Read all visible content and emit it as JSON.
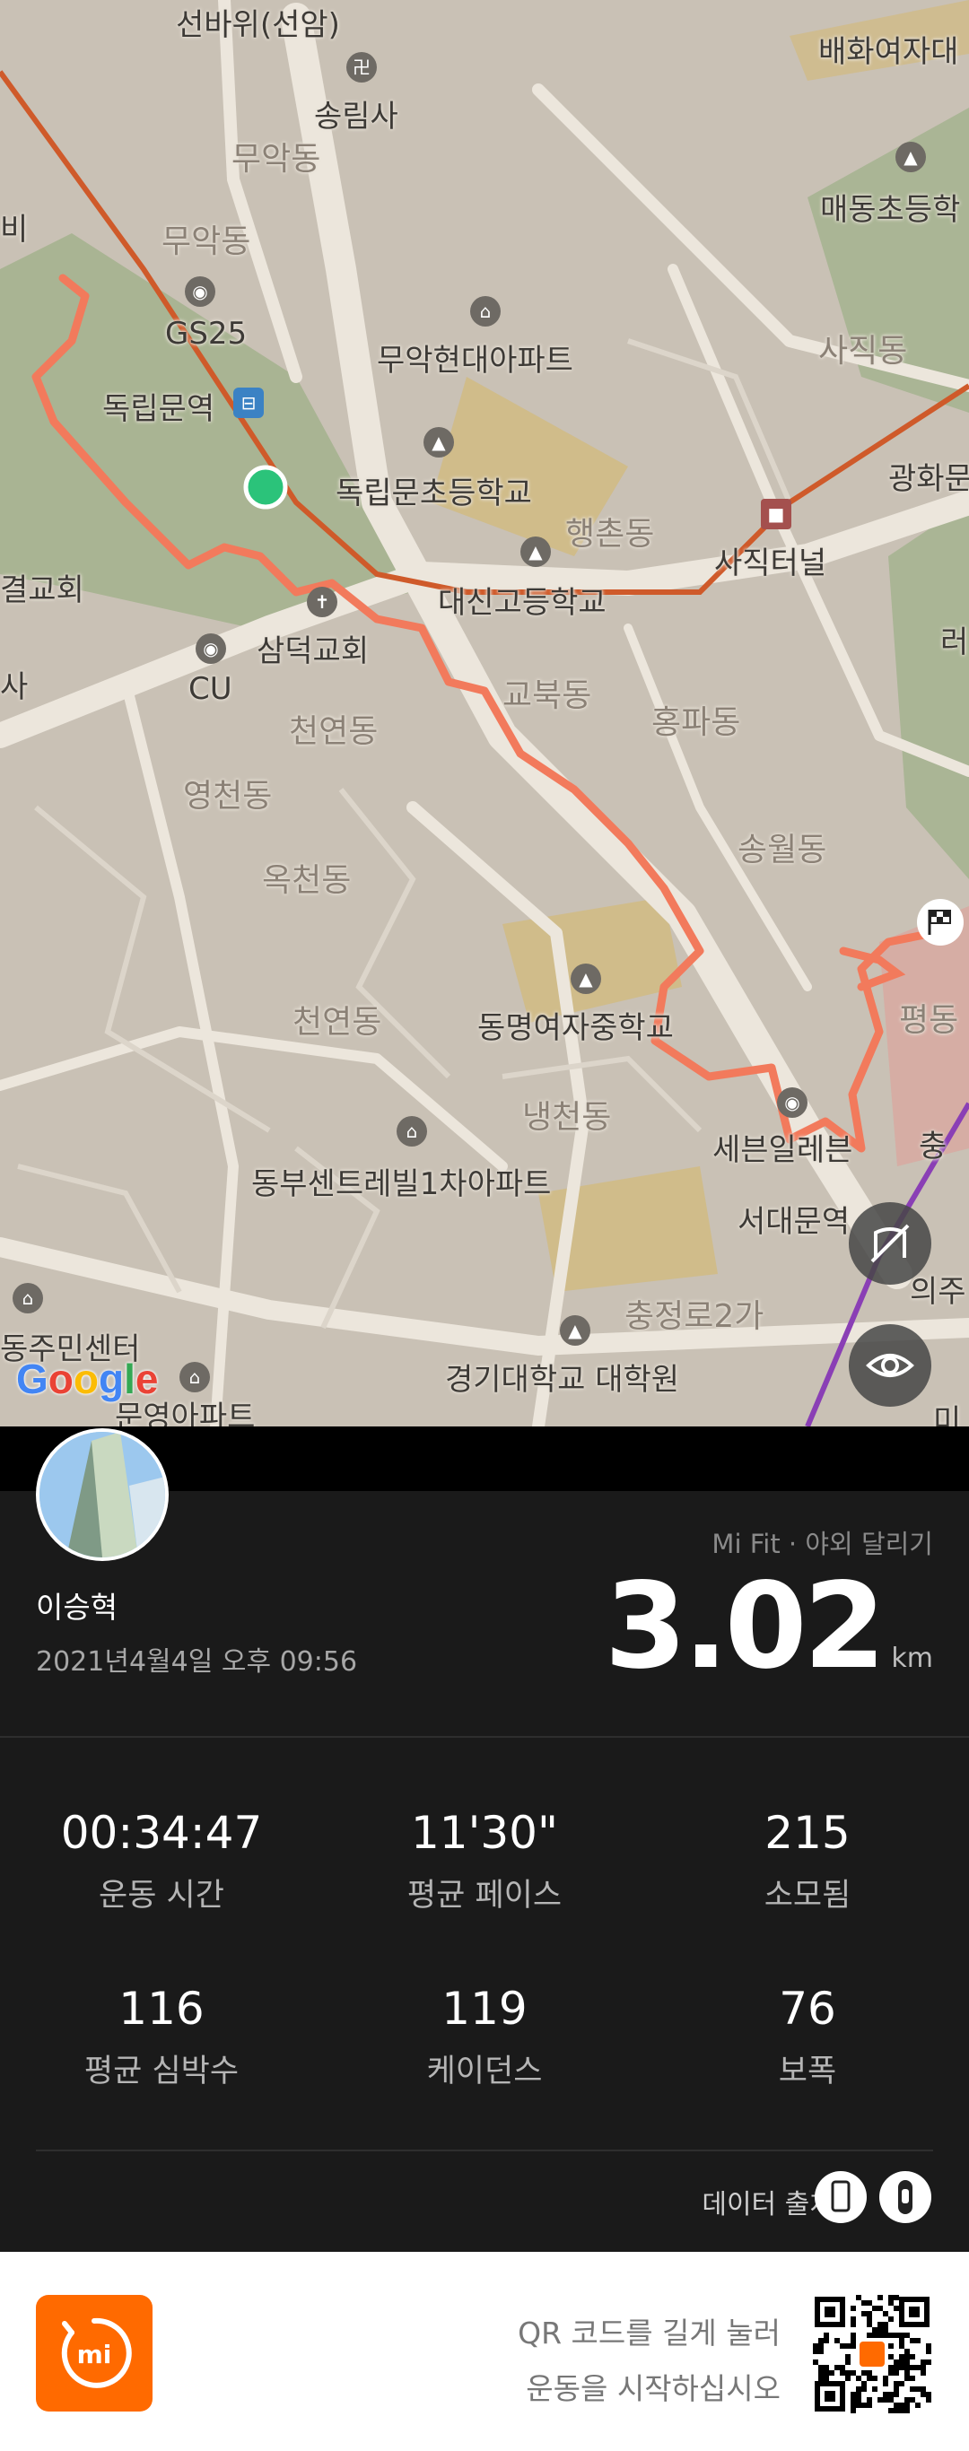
{
  "map": {
    "labels": {
      "seonbawi": "선바위(선암)",
      "baehwa": "배화여자대",
      "songrimsa": "송림사",
      "muak_dong_1": "무악동",
      "maedong_school": "매동초등학",
      "bi": "비",
      "muak_dong_2": "무악동",
      "gs25": "GS25",
      "muakhyeondae_apt": "무악현대아파트",
      "sajik_dong": "사직동",
      "dongnimmun_station": "독립문역",
      "dongnimmun_school": "독립문초등학교",
      "gwanghwamun": "광화문",
      "haengchon_dong": "행촌동",
      "sajik_tunnel": "사직터널",
      "gyeol_church": "결교회",
      "daesin_school": "대신고등학교",
      "samdeok_church": "삼덕교회",
      "sa": "사",
      "cu": "CU",
      "gyobuk_dong": "교북동",
      "hongpa_dong": "홍파동",
      "cheonyeon_dong_1": "천연동",
      "yeongcheon_dong": "영천동",
      "songwol_dong": "송월동",
      "okcheon_dong": "옥천동",
      "cheonyeon_dong_2": "천연동",
      "dongmyeong_school": "동명여자중학교",
      "pyeong_dong": "평동",
      "naengcheon_dong": "냉천동",
      "seven_eleven": "세븐일레븐",
      "dongbu_apt": "동부센트레빌1차아파트",
      "seodaemun_station": "서대문역",
      "chungjeongro": "충정로2가",
      "uiju": "의주",
      "community_center": "동주민센터",
      "kyonggi_grad": "경기대학교 대학원",
      "munyeong_apt": "문영아파트",
      "chung": "충",
      "re": "러",
      "mi": "미"
    },
    "google_logo": "Google",
    "buttons": {
      "hide_route_icon": "no-route-icon",
      "view_icon": "eye-icon"
    },
    "colors": {
      "route": "#f27a5c",
      "start_marker": "#2bc37a",
      "subway_line": "#cf5a2a",
      "park": "#a8b592"
    }
  },
  "workout": {
    "user_name": "이승혁",
    "datetime": "2021년4월4일 오후 09:56",
    "source": "Mi Fit · 야외 달리기",
    "distance": "3.02",
    "distance_unit": "km",
    "stats": [
      {
        "value": "00:34:47",
        "label": "운동 시간"
      },
      {
        "value": "11'30\"",
        "label": "평균 페이스"
      },
      {
        "value": "215",
        "label": "소모됨"
      },
      {
        "value": "116",
        "label": "평균 심박수"
      },
      {
        "value": "119",
        "label": "케이던스"
      },
      {
        "value": "76",
        "label": "보폭"
      }
    ],
    "data_source_label": "데이터 출처:"
  },
  "footer": {
    "qr_line1": "QR 코드를 길게 눌러",
    "qr_line2": "운동을 시작하십시오",
    "brand_color": "#ff6a00"
  }
}
